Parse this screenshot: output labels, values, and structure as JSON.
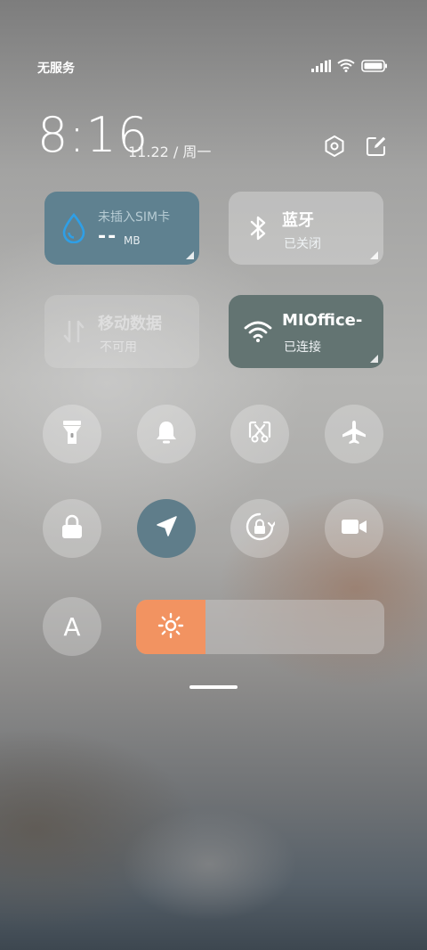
{
  "status_bar": {
    "carrier": "无服务",
    "icons": [
      "signal-icon",
      "wifi-icon",
      "battery-icon"
    ]
  },
  "header": {
    "time": "8:16",
    "date": "11.22 / 周一",
    "icons": [
      "settings-icon",
      "edit-icon"
    ]
  },
  "tiles": {
    "data_usage": {
      "title": "未插入SIM卡",
      "value": "--",
      "unit": "MB",
      "color": "#5f8190"
    },
    "bluetooth": {
      "title": "蓝牙",
      "status": "已关闭"
    },
    "mobile_data": {
      "title": "移动数据",
      "status": "不可用"
    },
    "wifi": {
      "title": "MIOffice-",
      "status": "已连接",
      "color": "#637472"
    }
  },
  "toggles": [
    {
      "name": "flashlight",
      "icon": "flashlight-icon",
      "active": false
    },
    {
      "name": "mute",
      "icon": "bell-icon",
      "active": false
    },
    {
      "name": "screenshot",
      "icon": "screenshot-icon",
      "active": false
    },
    {
      "name": "airplane-mode",
      "icon": "airplane-icon",
      "active": false
    },
    {
      "name": "lock-screen",
      "icon": "lock-icon",
      "active": false
    },
    {
      "name": "location",
      "icon": "location-icon",
      "active": true,
      "color": "#5f7d8a"
    },
    {
      "name": "auto-rotate",
      "icon": "rotate-lock-icon",
      "active": false
    },
    {
      "name": "screen-record",
      "icon": "video-icon",
      "active": false
    }
  ],
  "auto_brightness": {
    "label": "A"
  },
  "brightness": {
    "level": 0.28,
    "fill_color": "#f29361",
    "icon": "sun-icon"
  }
}
